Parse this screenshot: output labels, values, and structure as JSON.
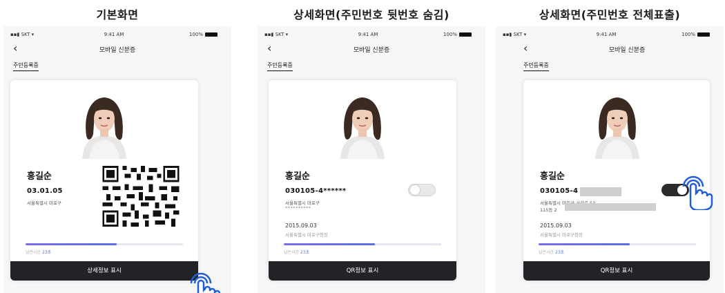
{
  "panels": [
    {
      "heading": "기본화면",
      "status": {
        "carrier": "SKT",
        "time": "9:41 AM",
        "battery": "100%"
      },
      "nav_title": "모바일 신분증",
      "tab": "주민등록증",
      "card": {
        "name": "홍길순",
        "dob": "03.01.05",
        "address": "서울특별시 마포구",
        "remaining_label": "남은시간",
        "remaining_value": "23초",
        "progress": 0.58
      },
      "button": "상세정보 표시"
    },
    {
      "heading": "상세화면(주민번호 뒷번호 숨김)",
      "status": {
        "carrier": "SKT",
        "time": "9:41 AM",
        "battery": "100%"
      },
      "nav_title": "모바일 신분증",
      "tab": "주민등록증",
      "card": {
        "name": "홍길순",
        "id_number": "030105-4******",
        "address": "서울특별시 마포구",
        "address_masked": "**********",
        "issue_date": "2015.09.03",
        "issuer": "서울특별시 마포구청장",
        "remaining_label": "남은시간",
        "remaining_value": "23초",
        "progress": 0.58,
        "toggle_on": false
      },
      "button": "QR정보 표시"
    },
    {
      "heading": "상세화면(주민번호 전체표출)",
      "status": {
        "carrier": "SKT",
        "time": "9:41 AM",
        "battery": "100%"
      },
      "nav_title": "모바일 신분증",
      "tab": "주민등록증",
      "card": {
        "name": "홍길순",
        "id_number": "030105-4",
        "address_line1": "서울특별시 마포구 서강로 53",
        "address_line2": "115동 2",
        "issue_date": "2015.09.03",
        "issuer": "서울특별시 마포구청장",
        "remaining_label": "남은시간",
        "remaining_value": "23초",
        "progress": 0.58,
        "toggle_on": true
      },
      "button": "QR정보 표시"
    }
  ],
  "colors": {
    "accent": "#5a6ee8",
    "button_bg": "#222326",
    "hand": "#1f5fd6"
  },
  "icons": [
    "back-arrow-icon",
    "signal-icon",
    "wifi-icon",
    "battery-icon",
    "qr-code-icon",
    "tap-hand-icon"
  ]
}
